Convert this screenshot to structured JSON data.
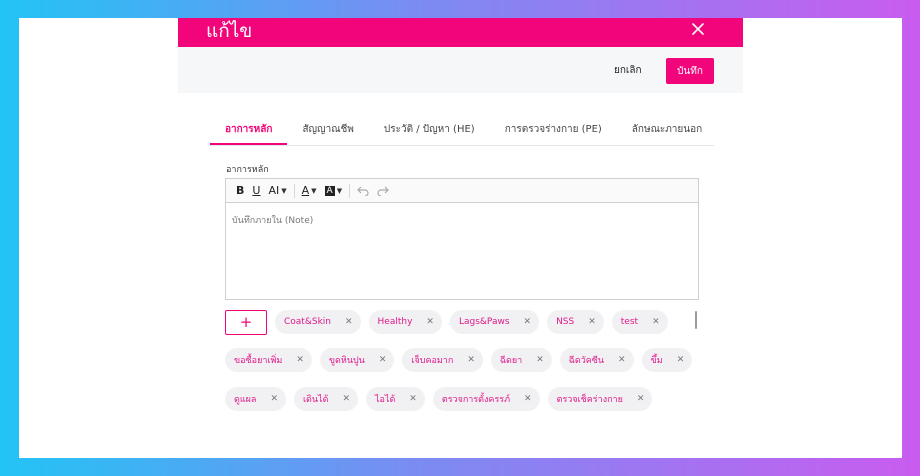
{
  "modal": {
    "title": "แก้ไข",
    "cancel_label": "ยกเลิก",
    "save_label": "บันทึก"
  },
  "tabs": [
    {
      "label": "อาการหลัก",
      "active": true
    },
    {
      "label": "สัญญาณชีพ",
      "active": false
    },
    {
      "label": "ประวัติ / ปัญหา (HE)",
      "active": false
    },
    {
      "label": "การตรวจร่างกาย (PE)",
      "active": false
    },
    {
      "label": "ลักษณะภายนอก",
      "active": false
    }
  ],
  "field": {
    "label": "อาการหลัก",
    "placeholder": "บันทึกภายใน (Note)"
  },
  "toolbar": {
    "bold": "B",
    "underline": "U",
    "font_size": "AI",
    "font_color": "A",
    "highlight": "A"
  },
  "chips": {
    "add_label": "+",
    "row1": [
      "Coat&Skin",
      "Healthy",
      "Lags&Paws",
      "NSS",
      "test"
    ],
    "row2": [
      "ขอซื้อยาเพิ่ม",
      "ขูดหินปูน",
      "เจ็บคอมาก",
      "ฉีดยา",
      "ฉีดวัคซีน",
      "ขึ้ม"
    ],
    "row3": [
      "ดูแผล",
      "เดินได้",
      "ไอได้",
      "ตรวจการตั้งครรภ์",
      "ตรวจเช็คร่างกาย"
    ]
  },
  "colors": {
    "accent": "#f2057a",
    "chip_text": "#e0198b"
  }
}
